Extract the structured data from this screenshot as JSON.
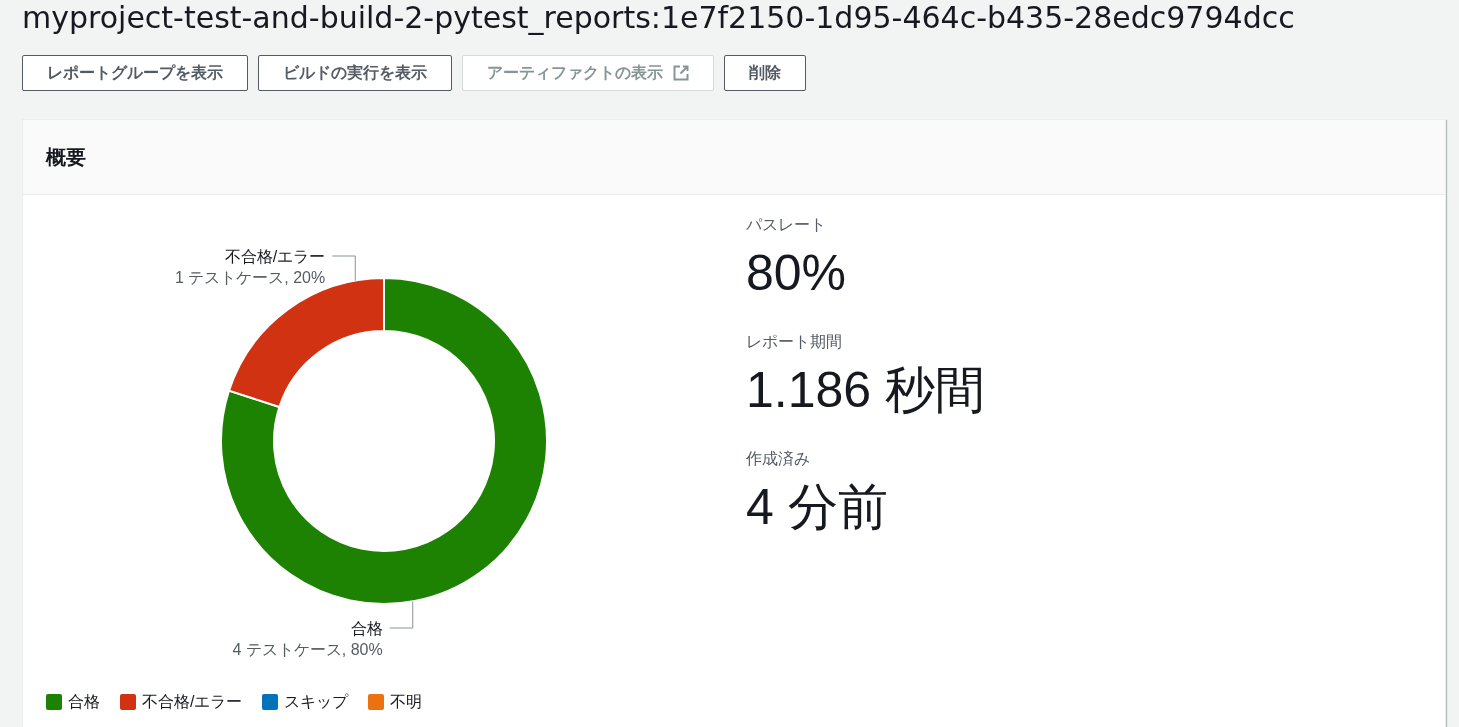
{
  "page": {
    "title": "myproject-test-and-build-2-pytest_reports:1e7f2150-1d95-464c-b435-28edc9794dcc"
  },
  "buttons": [
    {
      "label": "レポートグループを表示",
      "disabled": false,
      "external": false
    },
    {
      "label": "ビルドの実行を表示",
      "disabled": false,
      "external": false
    },
    {
      "label": "アーティファクトの表示",
      "disabled": true,
      "external": true
    },
    {
      "label": "削除",
      "disabled": false,
      "external": false
    }
  ],
  "summary": {
    "title": "概要",
    "chart": {
      "chart_data": {
        "type": "donut",
        "categories": [
          "合格",
          "不合格/エラー"
        ],
        "values": [
          4,
          1
        ],
        "value_labels": [
          "4 テストケース, 80%",
          "1 テストケース, 20%"
        ]
      },
      "legend": [
        {
          "label": "合格",
          "color": "#1d8102"
        },
        {
          "label": "不合格/エラー",
          "color": "#d13212"
        },
        {
          "label": "スキップ",
          "color": "#0073bb"
        },
        {
          "label": "不明",
          "color": "#ec7211"
        }
      ]
    },
    "stats": [
      {
        "label": "パスレート",
        "value": "80%"
      },
      {
        "label": "レポート期間",
        "value": "1.186 秒間"
      },
      {
        "label": "作成済み",
        "value": "4 分前"
      }
    ]
  }
}
